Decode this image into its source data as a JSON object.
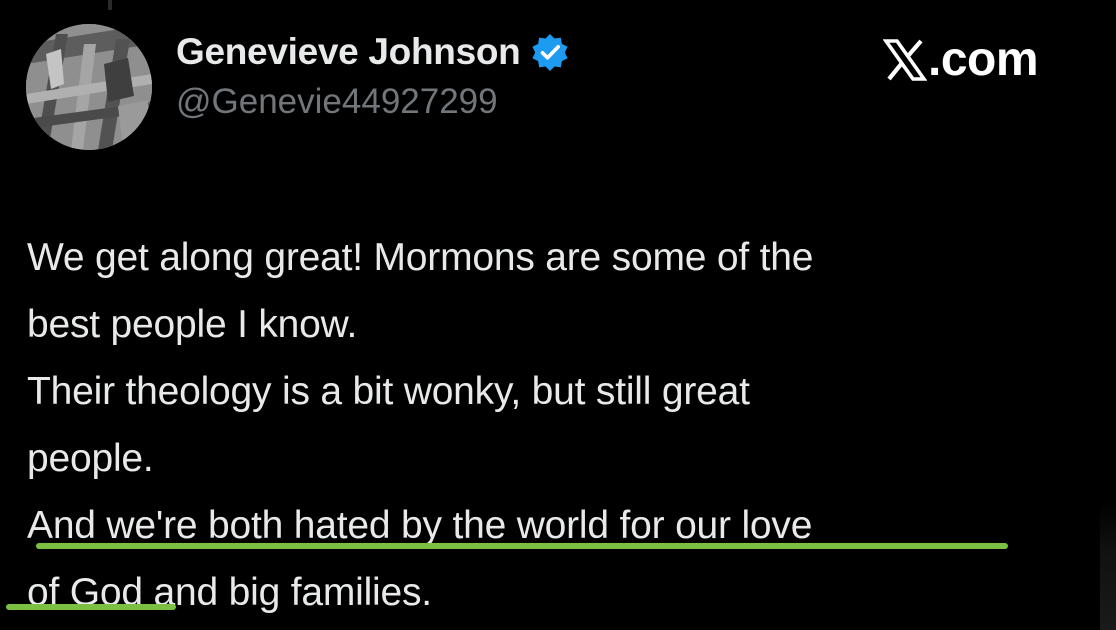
{
  "post": {
    "display_name": "Genevieve Johnson",
    "handle": "@Genevie44927299",
    "verified": true,
    "avatar_icon": "avatar-photo-icon",
    "brand_label": ".com",
    "brand_icon": "x-logo-icon",
    "text_lines": [
      "We get along great!  Mormons are some of the",
      "best people I know.",
      "Their theology is a bit wonky, but still great",
      "people.",
      "And we're both hated by the world for our love",
      "of God and big families."
    ],
    "highlighted_phrases": [
      "And we're both hated by the world for our love",
      "of God"
    ]
  },
  "colors": {
    "background": "#000000",
    "text": "#e7e9ea",
    "handle": "#71767b",
    "verified_badge": "#1d9bf0",
    "highlight_underline": "#7bc043"
  }
}
